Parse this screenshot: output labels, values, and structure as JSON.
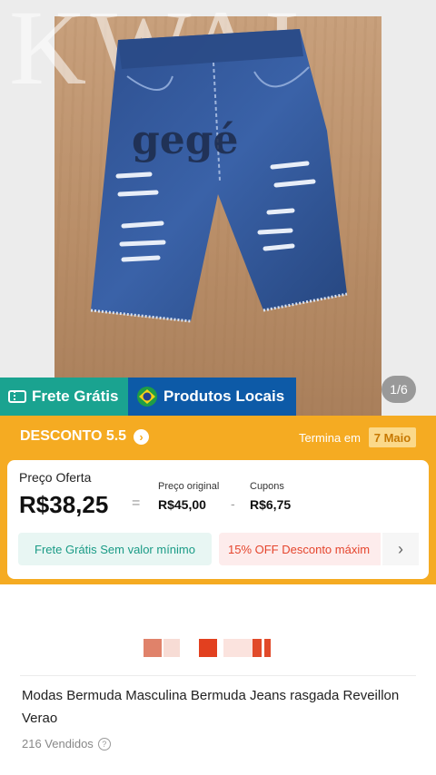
{
  "hero": {
    "watermark": "KWAI",
    "image_counter": "1/6",
    "badges": {
      "frete": "Frete Grátis",
      "local": "Produtos Locais"
    }
  },
  "promo": {
    "title": "DESCONTO 5.5",
    "ends_label": "Termina em",
    "ends_date": "7 Maio",
    "price_offer_label": "Preço Oferta",
    "price_offer": "R$38,25",
    "original_label": "Preço original",
    "original_value": "R$45,00",
    "coupons_label": "Cupons",
    "coupons_value": "R$6,75",
    "chip_frete": "Frete Grátis Sem valor mínimo",
    "chip_off": "15% OFF Desconto máxim"
  },
  "product": {
    "title": "Modas Bermuda Masculina Bermuda Jeans rasgada Reveillon Verao",
    "sold": "216 Vendidos"
  },
  "colors": {
    "teal": "#1aa390",
    "blue": "#0d5aa7",
    "orange": "#f5ab22",
    "red_accent": "#e5452d"
  }
}
